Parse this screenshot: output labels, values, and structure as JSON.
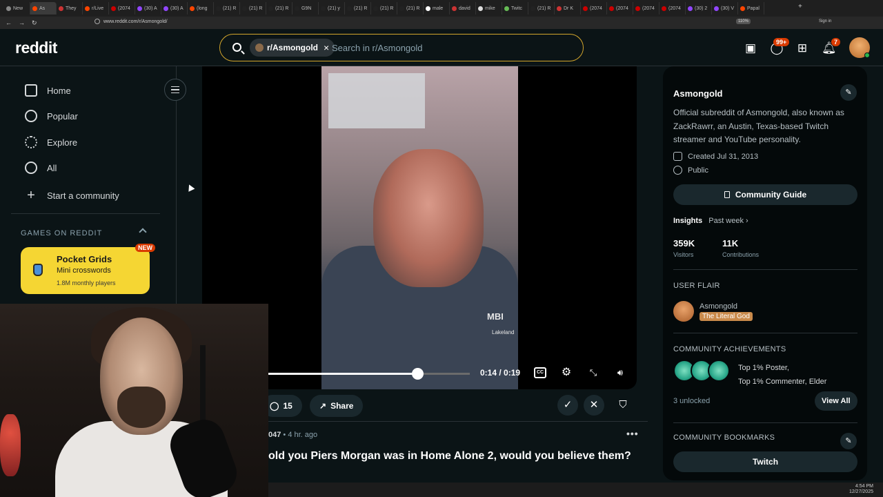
{
  "browser": {
    "tabs": [
      "New",
      "As",
      "They",
      "r/Live",
      "(2074",
      "(30) A",
      "(30) A",
      "(long",
      "(21) R",
      "(21) R",
      "(21) R",
      "G9N",
      "(21) y",
      "(21) R",
      "(21) R",
      "(21) R",
      "male",
      "david",
      "mike",
      "Twitc",
      "(21) R",
      "Dr K",
      "(2074",
      "(2074",
      "(2074",
      "(2074",
      "(30) 2",
      "(30) V",
      "Papal"
    ],
    "url": "www.reddit.com/r/Asmongold/",
    "zoom": "110%",
    "sign_in": "Sign in"
  },
  "header": {
    "logo": "reddit",
    "search_chip": "r/Asmongold",
    "search_placeholder": "Search in r/Asmongold",
    "chat_badge": "99+",
    "notif_badge": "7"
  },
  "leftnav": {
    "items": [
      "Home",
      "Popular",
      "Explore",
      "All",
      "Start a community"
    ],
    "games_heading": "GAMES ON REDDIT",
    "game": {
      "title": "Pocket Grids",
      "subtitle": "Mini crosswords",
      "players": "1.8M monthly players",
      "badge": "NEW"
    }
  },
  "video": {
    "time": "0:14 / 0:19",
    "progress": 0.74,
    "shirt_logo": "MBI",
    "shirt_sub": "Lakeland"
  },
  "post": {
    "comments": "15",
    "share": "Share",
    "author_fragment": "047",
    "time_ago": "• 4 hr. ago",
    "title": "old you Piers Morgan was in Home Alone 2, would you believe them?"
  },
  "sidebar": {
    "name": "Asmongold",
    "description": "Official subreddit of Asmongold, also known as ZackRawrr, an Austin, Texas-based Twitch streamer and YouTube personality.",
    "created": "Created Jul 31, 2013",
    "visibility": "Public",
    "guide_button": "Community Guide",
    "insights_label": "Insights",
    "insights_period": "Past week ›",
    "visitors_value": "359K",
    "visitors_label": "Visitors",
    "contributions_value": "11K",
    "contributions_label": "Contributions",
    "user_flair_heading": "USER FLAIR",
    "flair_user": "Asmongold",
    "flair_tag": "The Literal God",
    "achievements_heading": "COMMUNITY ACHIEVEMENTS",
    "achievement_line1": "Top 1% Poster,",
    "achievement_line2": "Top 1% Commenter, Elder",
    "unlocked": "3 unlocked",
    "view_all": "View All",
    "bookmarks_heading": "COMMUNITY BOOKMARKS",
    "bookmark_1": "Twitch"
  },
  "taskbar": {
    "time": "4:54 PM",
    "date": "12/27/2025"
  },
  "colors": {
    "accent": "#d93a00",
    "search_border": "#d4a72c",
    "game_card": "#f5d633",
    "flair": "#c98a4b"
  }
}
